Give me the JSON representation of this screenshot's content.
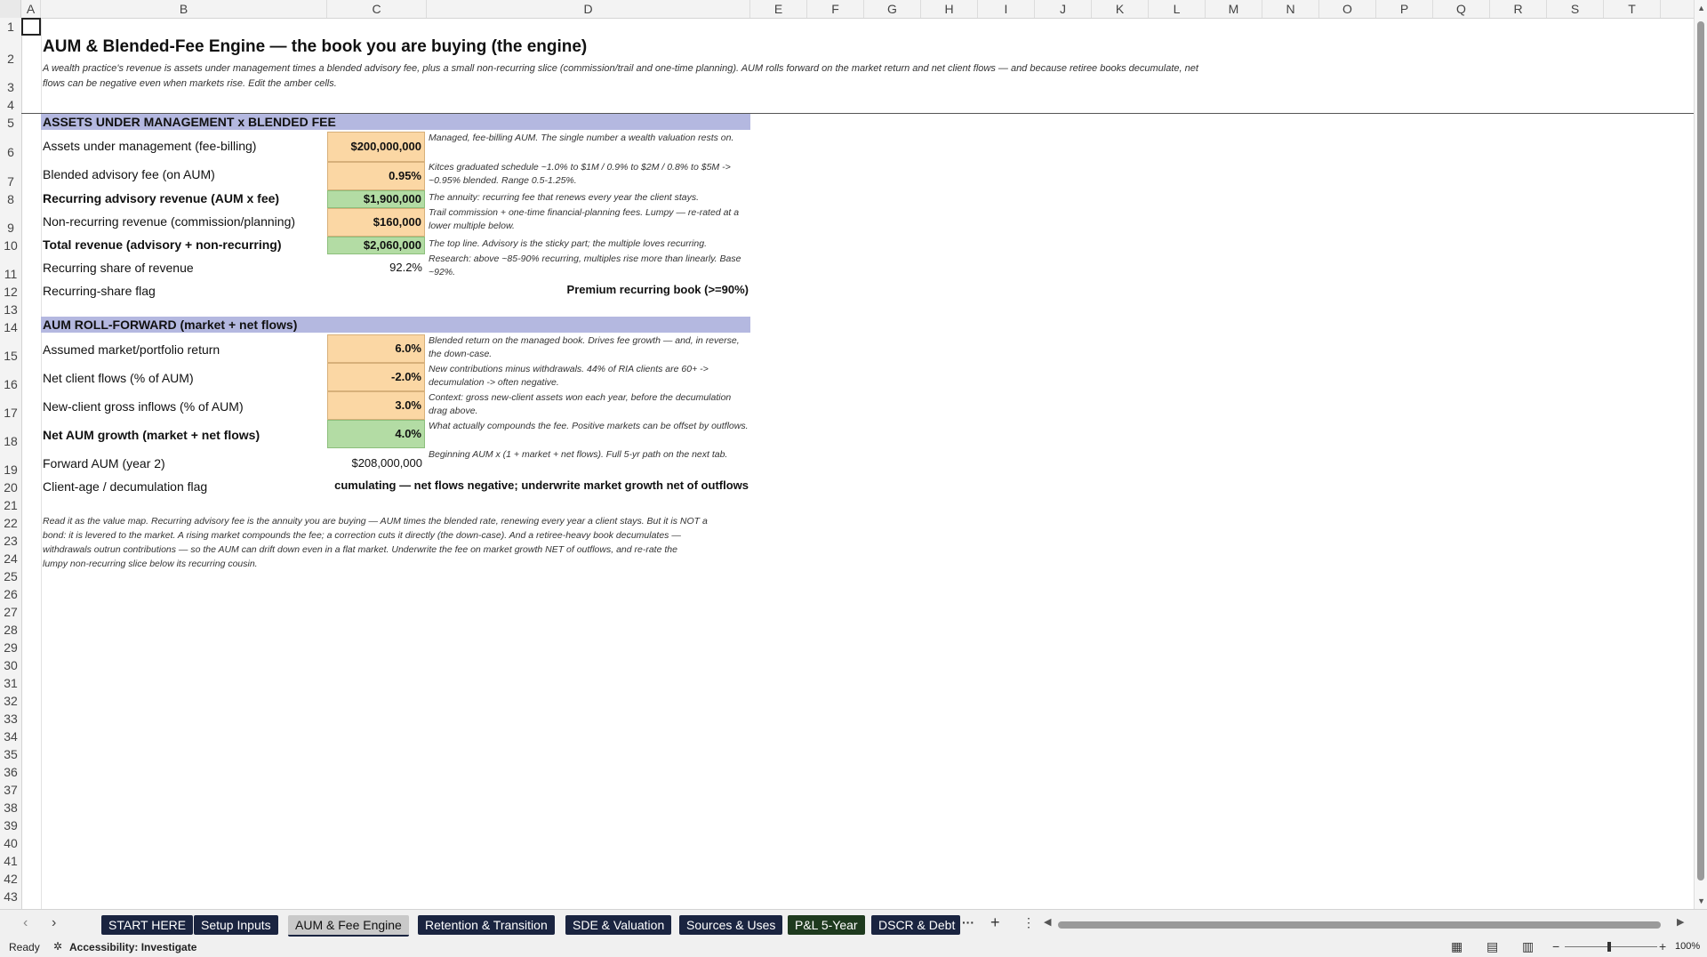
{
  "columns": [
    "A",
    "B",
    "C",
    "D",
    "E",
    "F",
    "G",
    "H",
    "I",
    "J",
    "K",
    "L",
    "M",
    "N",
    "O",
    "P",
    "Q",
    "R",
    "S",
    "T"
  ],
  "rows": [
    "1",
    "2",
    "3",
    "4",
    "5",
    "6",
    "7",
    "8",
    "9",
    "10",
    "11",
    "12",
    "13",
    "14",
    "15",
    "16",
    "17",
    "18",
    "19",
    "20",
    "21",
    "22",
    "23",
    "24",
    "25",
    "26",
    "27",
    "28",
    "29",
    "30",
    "31",
    "32",
    "33",
    "34",
    "35",
    "36",
    "37",
    "38",
    "39",
    "40",
    "41",
    "42",
    "43"
  ],
  "sheet": {
    "title": "AUM & Blended-Fee Engine — the book you are buying (the engine)",
    "intro_line1": "A wealth practice's revenue is assets under management times a blended advisory fee, plus a small non-recurring slice (commission/trail and one-time planning). AUM rolls forward on the market return and net client flows — and because retiree books decumulate, net",
    "intro_line2": "flows can be negative even when markets rise. Edit the amber cells.",
    "section1": "ASSETS UNDER MANAGEMENT x BLENDED FEE",
    "section2": "AUM ROLL-FORWARD  (market + net flows)",
    "r6": {
      "label": "Assets under management (fee-billing)",
      "value": "$200,000,000",
      "note": "Managed, fee-billing AUM. The single number a wealth valuation rests on."
    },
    "r7": {
      "label": "Blended advisory fee (on AUM)",
      "value": "0.95%",
      "note": "Kitces graduated schedule ~1.0% to $1M / 0.9% to $2M / 0.8% to $5M -> ~0.95% blended. Range 0.5-1.25%."
    },
    "r8": {
      "label": "Recurring advisory revenue (AUM x fee)",
      "value": "$1,900,000",
      "note": "The annuity: recurring fee that renews every year the client stays."
    },
    "r9": {
      "label": "Non-recurring revenue (commission/planning)",
      "value": "$160,000",
      "note": "Trail commission + one-time financial-planning fees. Lumpy — re-rated at a lower multiple below."
    },
    "r10": {
      "label": "Total revenue (advisory + non-recurring)",
      "value": "$2,060,000",
      "note": "The top line. Advisory is the sticky part; the multiple loves recurring."
    },
    "r11": {
      "label": "Recurring share of revenue",
      "value": "92.2%",
      "note": "Research: above ~85-90% recurring, multiples rise more than linearly. Base ~92%."
    },
    "r12": {
      "label": "Recurring-share flag",
      "value": "Premium recurring book (>=90%)"
    },
    "r15": {
      "label": "Assumed market/portfolio return",
      "value": "6.0%",
      "note": "Blended return on the managed book. Drives fee growth — and, in reverse, the down-case."
    },
    "r16": {
      "label": "Net client flows (% of AUM)",
      "value": "-2.0%",
      "note": "New contributions minus withdrawals. 44% of RIA clients are 60+ -> decumulation -> often negative."
    },
    "r17": {
      "label": "New-client gross inflows (% of AUM)",
      "value": "3.0%",
      "note": "Context: gross new-client assets won each year, before the decumulation drag above."
    },
    "r18": {
      "label": "Net AUM growth (market + net flows)",
      "value": "4.0%",
      "note": "What actually compounds the fee. Positive markets can be offset by outflows."
    },
    "r19": {
      "label": "Forward AUM (year 2)",
      "value": "$208,000,000",
      "note": "Beginning AUM x (1 + market + net flows). Full 5-yr path on the next tab."
    },
    "r20": {
      "label": "Client-age / decumulation flag",
      "value": "cumulating — net flows negative; underwrite market growth net of outflows"
    },
    "footer": [
      "Read it as the value map. Recurring advisory fee is the annuity you are buying — AUM times the blended rate, renewing every year a client stays. But it is NOT a",
      "bond: it is levered to the market. A rising market compounds the fee; a correction cuts it directly (the down-case). And a retiree-heavy book decumulates —",
      "withdrawals outrun contributions — so the AUM can drift down even in a flat market. Underwrite the fee on market growth NET of outflows, and re-rate the",
      "lumpy non-recurring slice below its recurring cousin."
    ]
  },
  "tabs": [
    "START HERE",
    "Setup Inputs",
    "AUM & Fee Engine",
    "Retention & Transition",
    "SDE & Valuation",
    "Sources & Uses",
    "P&L 5-Year",
    "DSCR & Debt"
  ],
  "active_tab": "AUM & Fee Engine",
  "status": {
    "ready": "Ready",
    "accessibility": "Accessibility: Investigate",
    "zoom": "100%"
  },
  "colors": {
    "amber": "#fbd7a4",
    "green": "#b3dca4",
    "band": "#b4b8e0",
    "tab_dark": "#1a2440"
  }
}
